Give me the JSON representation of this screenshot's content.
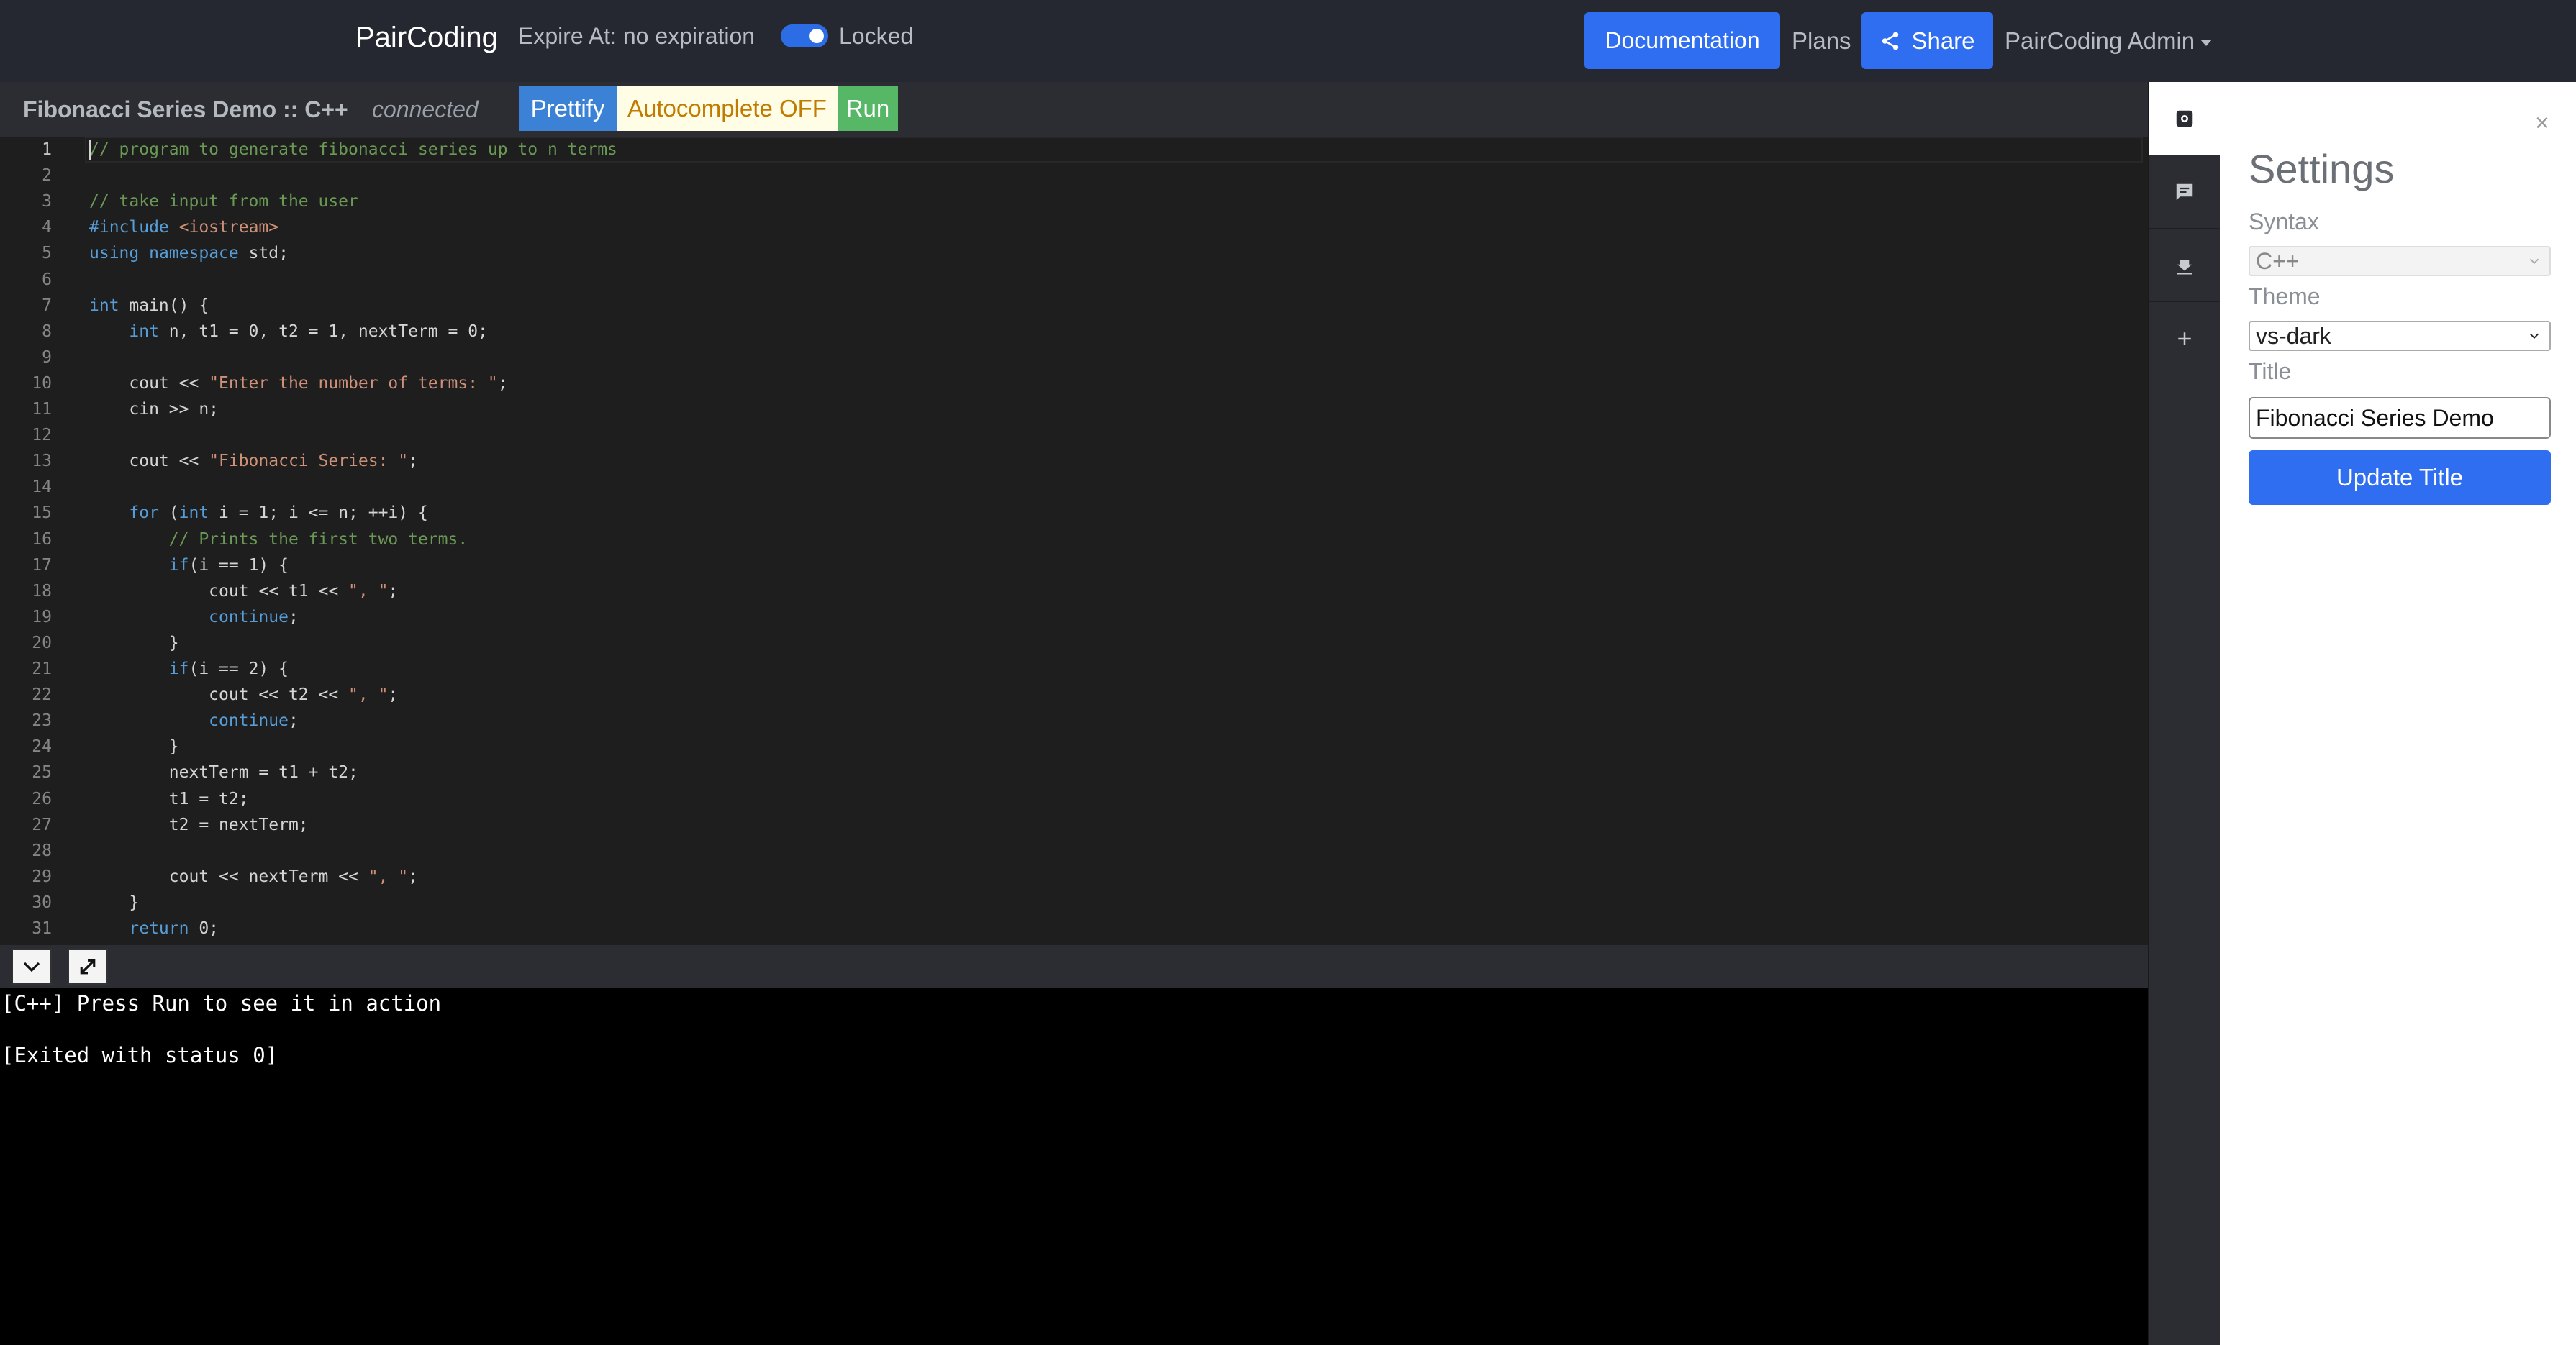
{
  "navbar": {
    "brand": "PairCoding",
    "expire": "Expire At: no expiration",
    "locked_label": "Locked",
    "documentation": "Documentation",
    "plans": "Plans",
    "share": "Share",
    "admin": "PairCoding Admin",
    "toggle_on": true,
    "accent_color": "#2f6ef0"
  },
  "editor_header": {
    "title": "Fibonacci Series Demo :: C++",
    "status": "connected",
    "prettify": "Prettify",
    "autocomplete": "Autocomplete OFF",
    "run": "Run"
  },
  "editor": {
    "current_line": 1,
    "lines": [
      "// program to generate fibonacci series up to n terms",
      "",
      "// take input from the user",
      "#include <iostream>",
      "using namespace std;",
      "",
      "int main() {",
      "    int n, t1 = 0, t2 = 1, nextTerm = 0;",
      "",
      "    cout << \"Enter the number of terms: \";",
      "    cin >> n;",
      "",
      "    cout << \"Fibonacci Series: \";",
      "",
      "    for (int i = 1; i <= n; ++i) {",
      "        // Prints the first two terms.",
      "        if(i == 1) {",
      "            cout << t1 << \", \";",
      "            continue;",
      "        }",
      "        if(i == 2) {",
      "            cout << t2 << \", \";",
      "            continue;",
      "        }",
      "        nextTerm = t1 + t2;",
      "        t1 = t2;",
      "        t2 = nextTerm;",
      "",
      "        cout << nextTerm << \", \";",
      "    }",
      "    return 0;"
    ]
  },
  "console": {
    "lines": [
      "[C++] Press Run to see it in action",
      "",
      "[Exited with status 0]"
    ]
  },
  "sidebar_icons": [
    "settings-icon",
    "chat-icon",
    "download-icon",
    "plus-icon"
  ],
  "settings": {
    "title": "Settings",
    "syntax_label": "Syntax",
    "syntax_value": "C++",
    "theme_label": "Theme",
    "theme_value": "vs-dark",
    "title_label": "Title",
    "title_value": "Fibonacci Series Demo",
    "update_button": "Update Title"
  }
}
